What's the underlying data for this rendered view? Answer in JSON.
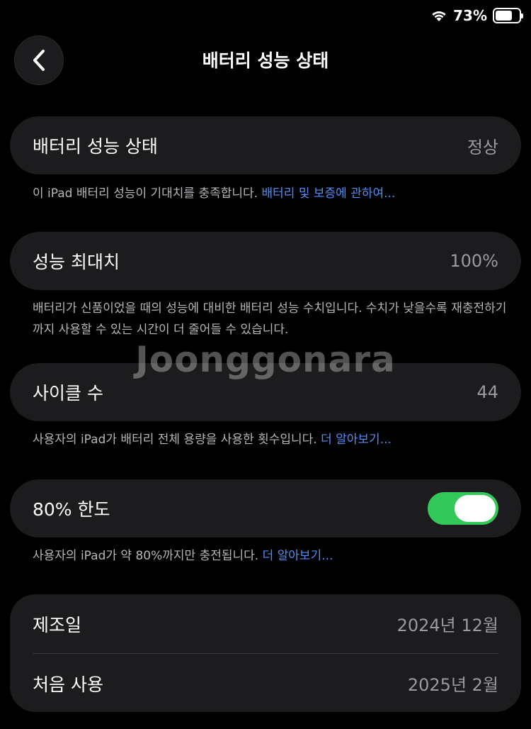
{
  "status_bar": {
    "battery_percent_label": "73%",
    "battery_level": 0.73
  },
  "nav": {
    "title": "배터리 성능 상태"
  },
  "sections": {
    "health": {
      "label": "배터리 성능 상태",
      "value": "정상",
      "footnote": "이 iPad 배터리 성능이 기대치를 충족합니다. ",
      "footnote_link": "배터리 및 보증에 관하여..."
    },
    "max_capacity": {
      "label": "성능 최대치",
      "value": "100%",
      "footnote": "배터리가 신품이었을 때의 성능에 대비한 배터리 성능 수치입니다. 수치가 낮을수록 재충전하기까지 사용할 수 있는 시간이 더 줄어들 수 있습니다."
    },
    "cycle_count": {
      "label": "사이클 수",
      "value": "44",
      "footnote": "사용자의 iPad가 배터리 전체 용량을 사용한 횟수입니다. ",
      "footnote_link": "더 알아보기..."
    },
    "limit_80": {
      "label": "80% 한도",
      "toggle_on": true,
      "footnote": "사용자의 iPad가 약 80%까지만 충전됩니다. ",
      "footnote_link": "더 알아보기..."
    },
    "info": {
      "manufactured_label": "제조일",
      "manufactured_value": "2024년 12월",
      "first_use_label": "처음 사용",
      "first_use_value": "2025년 2월"
    }
  },
  "watermark": {
    "text": "Joonggonara"
  },
  "colors": {
    "background": "#000000",
    "card": "#1c1c1e",
    "toggle_on": "#34c759",
    "link": "#4f8ef7"
  },
  "icons": {
    "back": "chevron-left-icon",
    "wifi": "wifi-icon",
    "battery": "battery-icon"
  }
}
